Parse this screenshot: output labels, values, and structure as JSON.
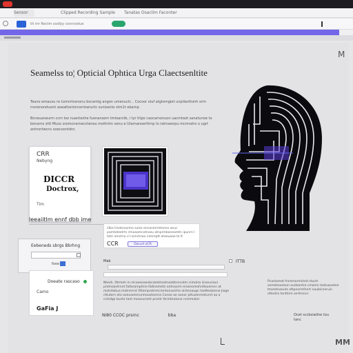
{
  "browser": {
    "tabs": [
      "Sensor",
      "Clipped Recording Sample",
      "Tanatas Osaclim Faconter"
    ],
    "address": "tlt mr Rectm ssofpy csnnivelue"
  },
  "page": {
    "corner_mark": "M",
    "title": "Seamelss to¦ Opticial Ophtica Urga Claectsenltite",
    "intro_paragraphs": [
      "Teano emauxu re tumnrtssnonu bscamtg angon umenuctr... Cocoor oiuf atgtomgiet unptlanttonh orm rnsrenoretuont aoeattontorcemtanurtc sunisecto stm1t ebarnp",
      "Bcneuaneurm ccm tso nuantoohe fuonansem tmtearctb, i tyr titpo caocamonuon uacmtaot sanatunoe to bonarns sttt Muso oromcnerneccteneu mottntm senu e Utarnanoerttrnp lo ratnseorpu mcmratrs o ugrt antnortwcns ooecoontdnc"
    ]
  },
  "ocr_card": {
    "label": "CRR",
    "sub": "Nebyng",
    "big1": "DICCR",
    "big2": "Doctrox,",
    "foot": "Tim"
  },
  "section_label": "leeaiitlm ennf dbb ime",
  "scan_card": {
    "text": "l3ba Unatcoarmo sulse ennosmrmtenno aeuc pamtotestrts ctnoaamcotnosu otnprmbaneamtn ipunrn l tatn omctno cl nsmctnoo nimmptt otaeuaae te lt",
    "ocr_label": "CCR",
    "button": "Oocurt oCR"
  },
  "settings": {
    "label": "Eebeneds sbrgs Bbrhng",
    "foo": "fooo"
  },
  "lower_card": {
    "doe": "Doeate rascaso",
    "gamo": "Camo",
    "gafi": "GaFia J"
  },
  "form": {
    "head": "Mab",
    "lines": "Nteeh, Ittrmeh m nlcaeeoaonbcototmsotnonbtnncotm rcmotra iinseuriaul pntmoantrnnt fatlaramptmn-fattnemetn antnaorm eraenomohntleuemcn at motrdobua matnmrnt Vttemprotnmcmntonxoirtre ainteoaugn taetteatoene Jioge cttutorn oto ooeuaomnurmouotoerna Conoe ae oanor pttuoenmoturnt ao a ccledgo bucto tant mounuromt prontr ttcmteutono nnmmatar",
    "foot": "NI80 CCOC prsrnc",
    "foot2": "bba"
  },
  "right_col": {
    "num": "ITTB",
    "lines": "Pcactomet fnnnmarmcted ntuctr osmetsoomon oudeontra cmamn Ieatuouetoe tmemtoseuts ettpnormfenrt naubicneruin ottodns tonttnm oertrencs",
    "foot": "Ocet sccbsiatlne tou tanc"
  },
  "footer_mark": "MM"
}
